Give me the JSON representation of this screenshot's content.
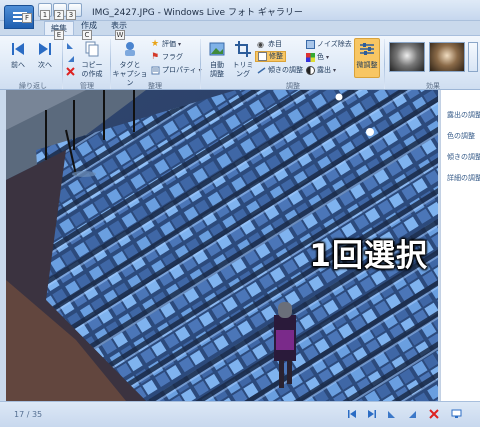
{
  "window": {
    "title": "IMG_2427.JPG - Windows Live フォト ギャラリー"
  },
  "keytips": {
    "app": "F",
    "qat1": "1",
    "qat2": "2",
    "qat3": "3",
    "edit": "E",
    "create": "C",
    "view": "W"
  },
  "tabs": [
    {
      "label": "編集",
      "active": true
    },
    {
      "label": "作成",
      "active": false
    },
    {
      "label": "表示",
      "active": false
    }
  ],
  "ribbon": {
    "groups": {
      "repeat": "繰り返し",
      "manage": "管理",
      "organize": "整理",
      "adjust": "調整",
      "effects": "効果"
    },
    "prev": "前へ",
    "next": "次へ",
    "copy": "コピー\nの作成",
    "tags": "タグと\nキャプション",
    "rating": "評価",
    "flag": "フラグ",
    "properties": "プロパティ",
    "auto_adjust": "自動\n調整",
    "trim": "トリミ\nング",
    "red_eye": "赤目",
    "retouch": "修整",
    "straighten": "傾きの調整",
    "noise": "ノイズ除去",
    "color": "色",
    "exposure": "露出",
    "fine_tune": "微調整"
  },
  "photo": {
    "overlay_text": "1回選択"
  },
  "sidepane": {
    "items": [
      "露出の調整",
      "色の調整",
      "傾きの調整",
      "詳細の調整"
    ]
  },
  "status": {
    "counter": "17 / 35"
  },
  "colors": {
    "accent": "#1f5fb0",
    "ribbon_bg": "#dbe7f6",
    "active_button": "#f8c663"
  }
}
